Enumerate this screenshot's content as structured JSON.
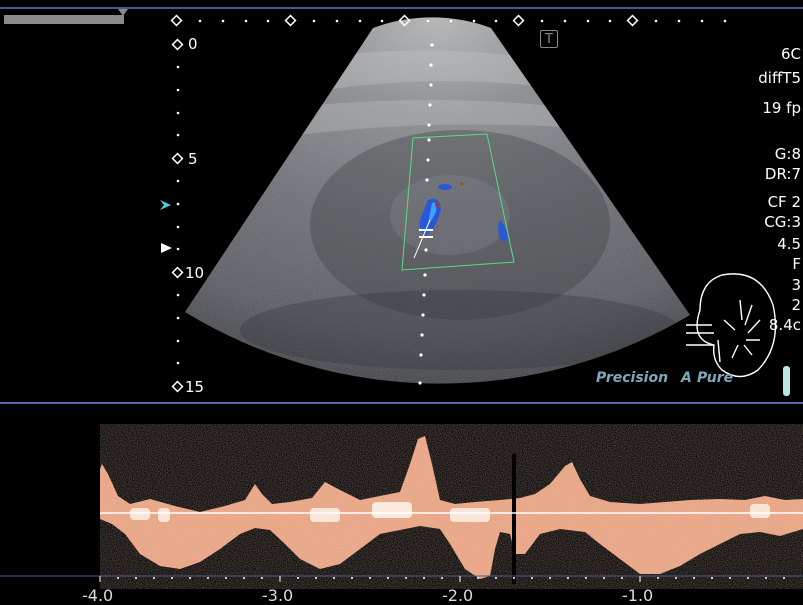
{
  "header": {
    "progress_fraction": 0.15
  },
  "depth_scale": {
    "labels": [
      "0",
      "5",
      "10",
      "15"
    ],
    "unit": "cm"
  },
  "params": {
    "probe": "6C",
    "preset": "diffT5",
    "frame_rate": "19 fp",
    "gain": "G:8",
    "dynamic_range": "DR:7",
    "color_freq": "CF 2",
    "color_gain": "CG:3",
    "prf": "4.5",
    "filter": "F",
    "angle": "3",
    "sv": "2",
    "depth": "8.4c"
  },
  "brand": {
    "precision": "Precision",
    "apure_a": "A",
    "apure": "Pure"
  },
  "t_icon": "T",
  "time_axis": {
    "labels": [
      "-4.0",
      "-3.0",
      "-2.0",
      "-1.0"
    ]
  },
  "icons": {
    "kidney": "kidney-icon",
    "focus": "focus-marker-icon",
    "transmit": "transmit-marker-icon"
  },
  "colors": {
    "border": "#4a5a8c",
    "doppler": "#f0b090",
    "color_flow": "#2a56d8",
    "roi": "#5adc8a"
  }
}
